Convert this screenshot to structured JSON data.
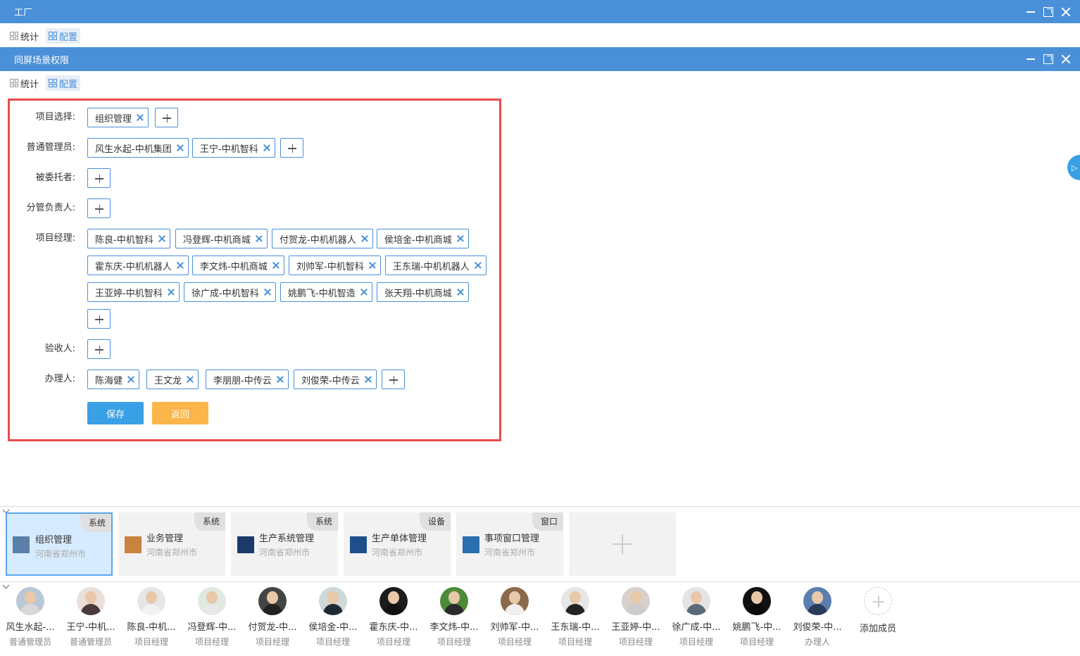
{
  "window1": {
    "title": "工厂"
  },
  "window2": {
    "title": "同屏场景权限"
  },
  "tabs": [
    {
      "label": "统计"
    },
    {
      "label": "配置"
    }
  ],
  "form": {
    "labels": {
      "project": "项目选择:",
      "admin": "普通管理员:",
      "delegate": "被委托者:",
      "division": "分管负责人:",
      "pm": "项目经理:",
      "acceptor": "验收人:",
      "handler": "办理人:"
    },
    "project": [
      "组织管理"
    ],
    "admin": [
      "风生水起-中机集团",
      "王宁-中机智科"
    ],
    "pm": [
      "陈良-中机智科",
      "冯登辉-中机商城",
      "付贺龙-中机机器人",
      "侯培金-中机商城",
      "霍东庆-中机机器人",
      "李文炜-中机商城",
      "刘帅军-中机智科",
      "王东瑞-中机机器人",
      "王亚婷-中机智科",
      "徐广成-中机智科",
      "姚鹏飞-中机智造",
      "张天翔-中机商城"
    ],
    "handler": [
      "陈海健",
      "王文龙",
      "李朋朋-中传云",
      "刘俊荣-中传云"
    ],
    "save": "保存",
    "back": "返回"
  },
  "scenes": [
    {
      "name": "组织管理",
      "location": "河南省郑州市",
      "badge": "系统",
      "thumb": "#5b7fa8"
    },
    {
      "name": "业务管理",
      "location": "河南省郑州市",
      "badge": "系统",
      "thumb": "#c9823f"
    },
    {
      "name": "生产系统管理",
      "location": "河南省郑州市",
      "badge": "系统",
      "thumb": "#1b3a6b"
    },
    {
      "name": "生产单体管理",
      "location": "河南省郑州市",
      "badge": "设备",
      "thumb": "#1e4f8c"
    },
    {
      "name": "事项窗口管理",
      "location": "河南省郑州市",
      "badge": "窗口",
      "thumb": "#2a6fb0"
    }
  ],
  "members": [
    {
      "name": "风生水起-...",
      "role": "普通管理员"
    },
    {
      "name": "王宁-中机...",
      "role": "普通管理员"
    },
    {
      "name": "陈良-中机...",
      "role": "项目经理"
    },
    {
      "name": "冯登辉-中...",
      "role": "项目经理"
    },
    {
      "name": "付贺龙-中...",
      "role": "项目经理"
    },
    {
      "name": "侯培金-中...",
      "role": "项目经理"
    },
    {
      "name": "霍东庆-中...",
      "role": "项目经理"
    },
    {
      "name": "李文炜-中...",
      "role": "项目经理"
    },
    {
      "name": "刘帅军-中...",
      "role": "项目经理"
    },
    {
      "name": "王东瑞-中...",
      "role": "项目经理"
    },
    {
      "name": "王亚婷-中...",
      "role": "项目经理"
    },
    {
      "name": "徐广成-中...",
      "role": "项目经理"
    },
    {
      "name": "姚鹏飞-中...",
      "role": "项目经理"
    },
    {
      "name": "刘俊荣-中...",
      "role": "办理人"
    }
  ],
  "add_member": "添加成员"
}
